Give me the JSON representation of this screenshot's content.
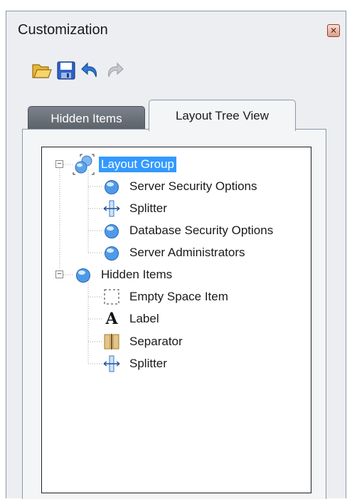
{
  "window": {
    "title": "Customization",
    "close_icon": "close-icon"
  },
  "toolbar": {
    "buttons": [
      {
        "name": "open",
        "icon": "folder-open-icon",
        "enabled": true
      },
      {
        "name": "save",
        "icon": "floppy-save-icon",
        "enabled": true
      },
      {
        "name": "undo",
        "icon": "undo-arrow-icon",
        "enabled": true
      },
      {
        "name": "redo",
        "icon": "redo-arrow-icon",
        "enabled": false
      }
    ]
  },
  "tabs": [
    {
      "label": "Hidden Items",
      "active": false
    },
    {
      "label": "Layout Tree View",
      "active": true
    }
  ],
  "tree": {
    "layout_group": {
      "label": "Layout Group",
      "selected": true,
      "expanded": true,
      "children": [
        {
          "label": "Server Security Options",
          "icon": "sphere-icon"
        },
        {
          "label": "Splitter",
          "icon": "splitter-icon"
        },
        {
          "label": "Database Security Options",
          "icon": "sphere-icon"
        },
        {
          "label": "Server Administrators",
          "icon": "sphere-icon"
        }
      ]
    },
    "hidden_items": {
      "label": "Hidden Items",
      "expanded": true,
      "children": [
        {
          "label": "Empty Space Item",
          "icon": "empty-space-icon"
        },
        {
          "label": "Label",
          "icon": "label-a-icon"
        },
        {
          "label": "Separator",
          "icon": "separator-icon"
        },
        {
          "label": "Splitter",
          "icon": "splitter-icon"
        }
      ]
    }
  },
  "colors": {
    "selection": "#3399ff",
    "frame_bg": "#eceef2",
    "border": "#8d97a6"
  }
}
